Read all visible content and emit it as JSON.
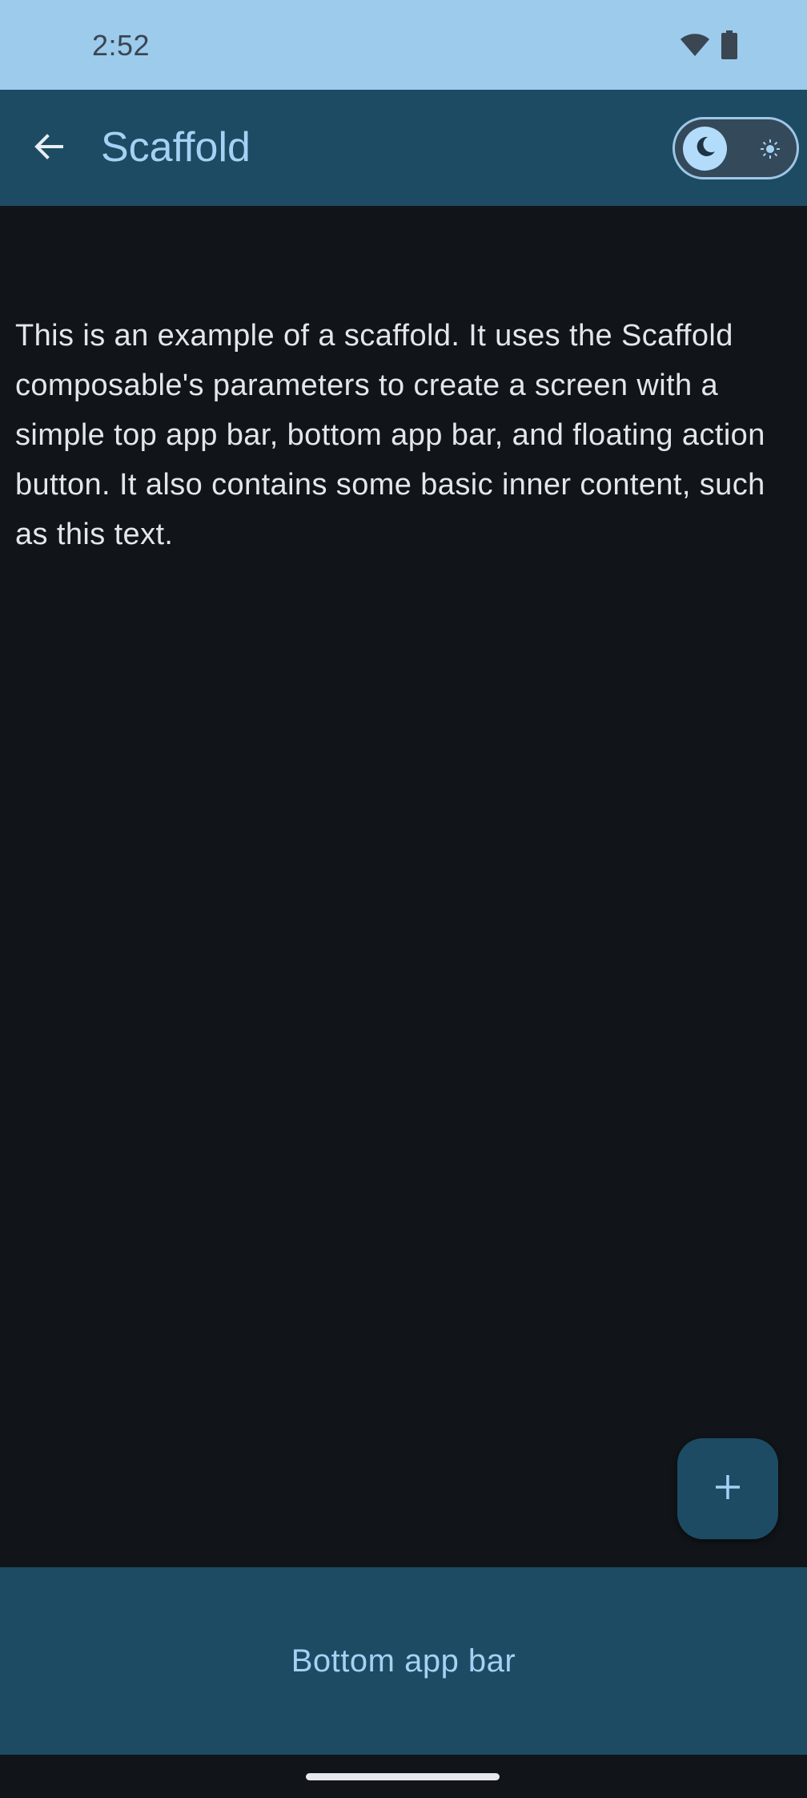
{
  "status_bar": {
    "time": "2:52",
    "icons": [
      "wifi-icon",
      "battery-icon"
    ]
  },
  "top_bar": {
    "title": "Scaffold",
    "back_icon": "arrow-left-icon",
    "theme_toggle": {
      "selected": "dark",
      "thumb_icon": "moon-icon",
      "other_icon": "sun-icon"
    }
  },
  "content": {
    "text": "This is an example of a scaffold. It uses the Scaffold composable's parameters to create a screen with a simple top app bar, bottom app bar, and floating action button. It also contains some basic inner content, such as this text."
  },
  "fab": {
    "icon": "plus-icon"
  },
  "bottom_bar": {
    "label": "Bottom app bar"
  },
  "colors": {
    "status_bar_bg": "#9ccbec",
    "app_bar_bg": "#1d4b64",
    "accent_text": "#a3d2f5",
    "background": "#111418",
    "body_text": "#e3e6ea"
  }
}
